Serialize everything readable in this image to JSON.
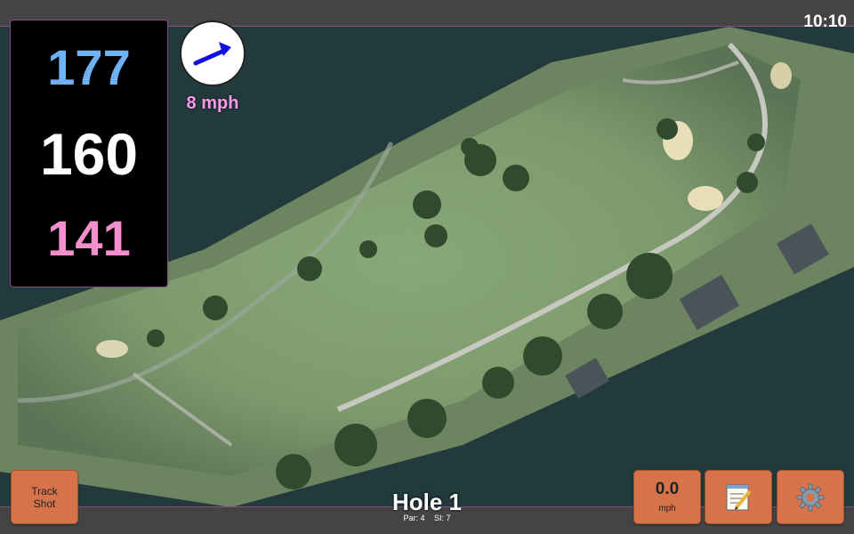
{
  "status": {
    "clock": "10:10"
  },
  "distances": {
    "back": "177",
    "middle": "160",
    "front": "141"
  },
  "wind": {
    "speed": "8 mph",
    "icon": "arrow-icon",
    "arrow_color": "#1010e0"
  },
  "track_button": {
    "label_line1": "Track",
    "label_line2": "Shot"
  },
  "speed_button": {
    "value": "0.0",
    "unit": "mph"
  },
  "notes_button": {
    "icon": "notepad-icon",
    "glyph": "📝"
  },
  "settings_button": {
    "icon": "gear-icon",
    "glyph": "⚙"
  },
  "hole": {
    "title": "Hole 1",
    "par": "Par: 4",
    "si": "SI: 7"
  },
  "colors": {
    "accent": "#d6734a",
    "back_dist": "#6fb1f5",
    "front_dist": "#f28fcc",
    "wind_text": "#ff99ee"
  }
}
